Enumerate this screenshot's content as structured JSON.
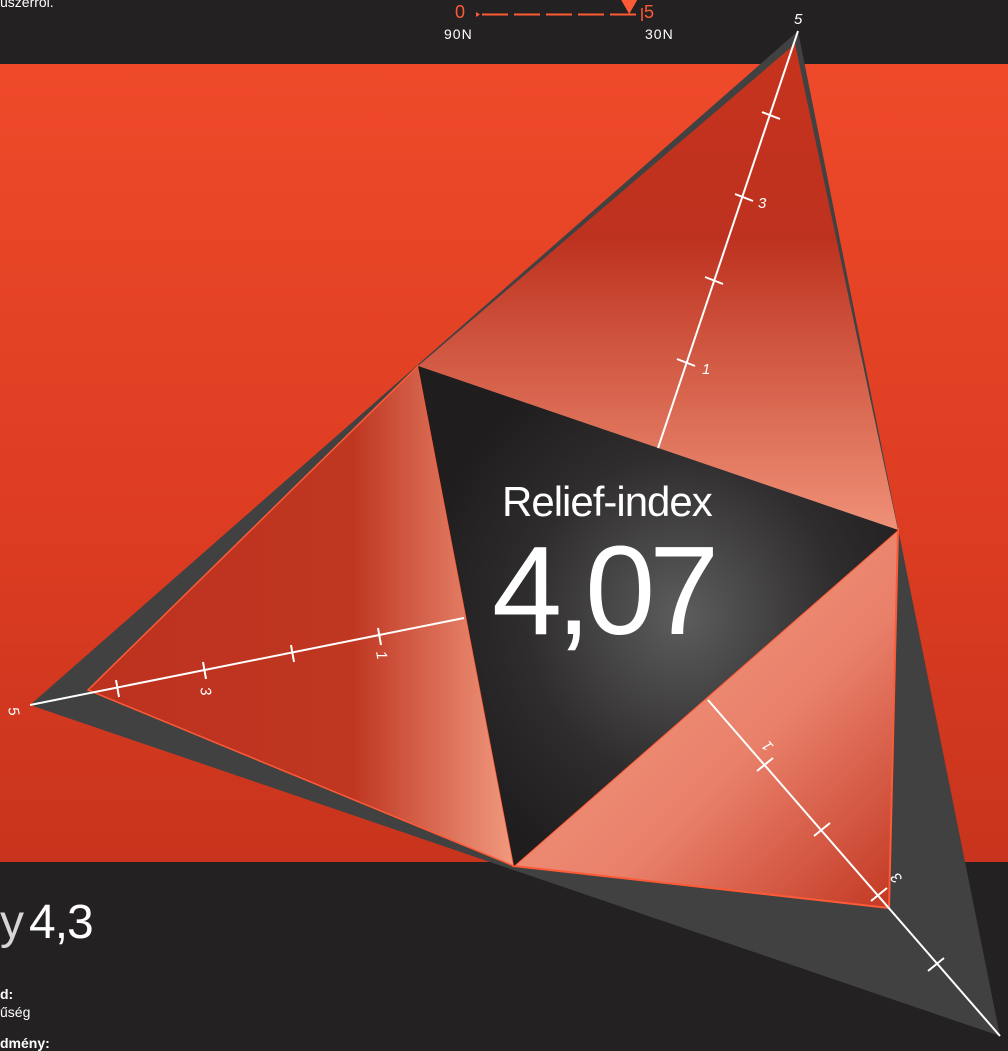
{
  "header": {
    "intro_text": "úszerről.",
    "scale": {
      "min_label": "0",
      "max_label": "5",
      "left_unit_label": "90N",
      "right_unit_label": "30N",
      "marker_value": 4.6
    }
  },
  "diagram": {
    "title": "Relief-index",
    "value": "4,07",
    "axis_labels": {
      "top_max": "5",
      "top_mid": "3",
      "top_low": "1",
      "left_max": "5",
      "left_mid": "3",
      "left_low": "1",
      "right_mid": "3",
      "right_low": "1"
    }
  },
  "bottom": {
    "value_prefix": "y",
    "value": "4,3",
    "label_1": "d:",
    "text_1": "űség",
    "label_2": "dmény:"
  },
  "colors": {
    "accent": "#ee4a2a",
    "dark": "#232122",
    "panel_gray": "#414142",
    "tick_orange": "#ff5a36"
  }
}
